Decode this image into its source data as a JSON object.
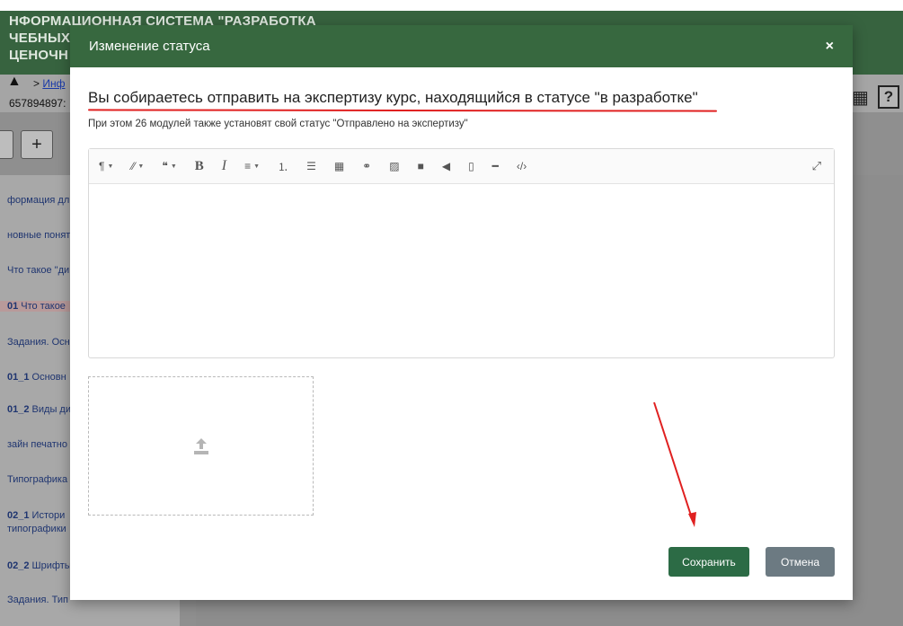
{
  "background": {
    "title_line1": "НФОРМАЦИОННАЯ СИСТЕМА \"РАЗРАБОТКА",
    "title_line2": "ЧЕБНЫХ",
    "title_line3": "ЦЕНОЧН",
    "breadcrumb_sep": ">",
    "breadcrumb_link": "Инф",
    "record_id": "657894897:",
    "add_button": "+",
    "sidebar_items": [
      {
        "bold": "",
        "text": "формация дл"
      },
      {
        "bold": "",
        "text": "новные поняти"
      },
      {
        "bold": "",
        "text": "Что такое \"ди"
      },
      {
        "bold": "01",
        "text": " Что такое"
      },
      {
        "bold": "",
        "text": "Задания. Осн"
      },
      {
        "bold": "01_1",
        "text": " Основн"
      },
      {
        "bold": "01_2",
        "text": " Виды ди"
      },
      {
        "bold": "",
        "text": "зайн печатно"
      },
      {
        "bold": "",
        "text": "Типографика"
      },
      {
        "bold": "02_1",
        "text": " Истори"
      },
      {
        "bold": "",
        "text": "типографики"
      },
      {
        "bold": "02_2",
        "text": " Шрифты"
      },
      {
        "bold": "",
        "text": "Задания. Тип"
      }
    ],
    "help_icon": "?"
  },
  "modal": {
    "title": "Изменение статуса",
    "close_label": "×",
    "message_main": "Вы собираетесь отправить на экспертизу курс, находящийся в статусе \"в разработке\"",
    "message_sub": "При этом 26 модулей также установят свой статус \"Отправлено на экспертизу\"",
    "editor_value": "",
    "toolbar": [
      {
        "name": "paragraph-icon",
        "glyph": "¶",
        "caret": true
      },
      {
        "name": "style-icon",
        "glyph": "⁄⁄",
        "caret": true
      },
      {
        "name": "quote-icon",
        "glyph": "❝",
        "caret": true
      },
      {
        "name": "bold-icon",
        "glyph": "B",
        "caret": false
      },
      {
        "name": "italic-icon",
        "glyph": "I",
        "caret": false
      },
      {
        "name": "align-icon",
        "glyph": "≡",
        "caret": true
      },
      {
        "name": "ordered-list-icon",
        "glyph": "⒈",
        "caret": false
      },
      {
        "name": "unordered-list-icon",
        "glyph": "☰",
        "caret": false
      },
      {
        "name": "table-icon",
        "glyph": "▦",
        "caret": false
      },
      {
        "name": "link-icon",
        "glyph": "⚭",
        "caret": false
      },
      {
        "name": "image-icon",
        "glyph": "▨",
        "caret": false
      },
      {
        "name": "video-icon",
        "glyph": "■",
        "caret": false
      },
      {
        "name": "audio-icon",
        "glyph": "◀",
        "caret": false
      },
      {
        "name": "file-icon",
        "glyph": "▯",
        "caret": false
      },
      {
        "name": "hr-icon",
        "glyph": "━",
        "caret": false
      },
      {
        "name": "code-icon",
        "glyph": "‹/›",
        "caret": false
      }
    ],
    "expand_glyph": "⤢",
    "save_label": "Сохранить",
    "cancel_label": "Отмена"
  },
  "colors": {
    "header_green": "#37683f",
    "save_green": "#2c6b45",
    "cancel_gray": "#6c7a82",
    "annotation_red": "#e02020"
  }
}
